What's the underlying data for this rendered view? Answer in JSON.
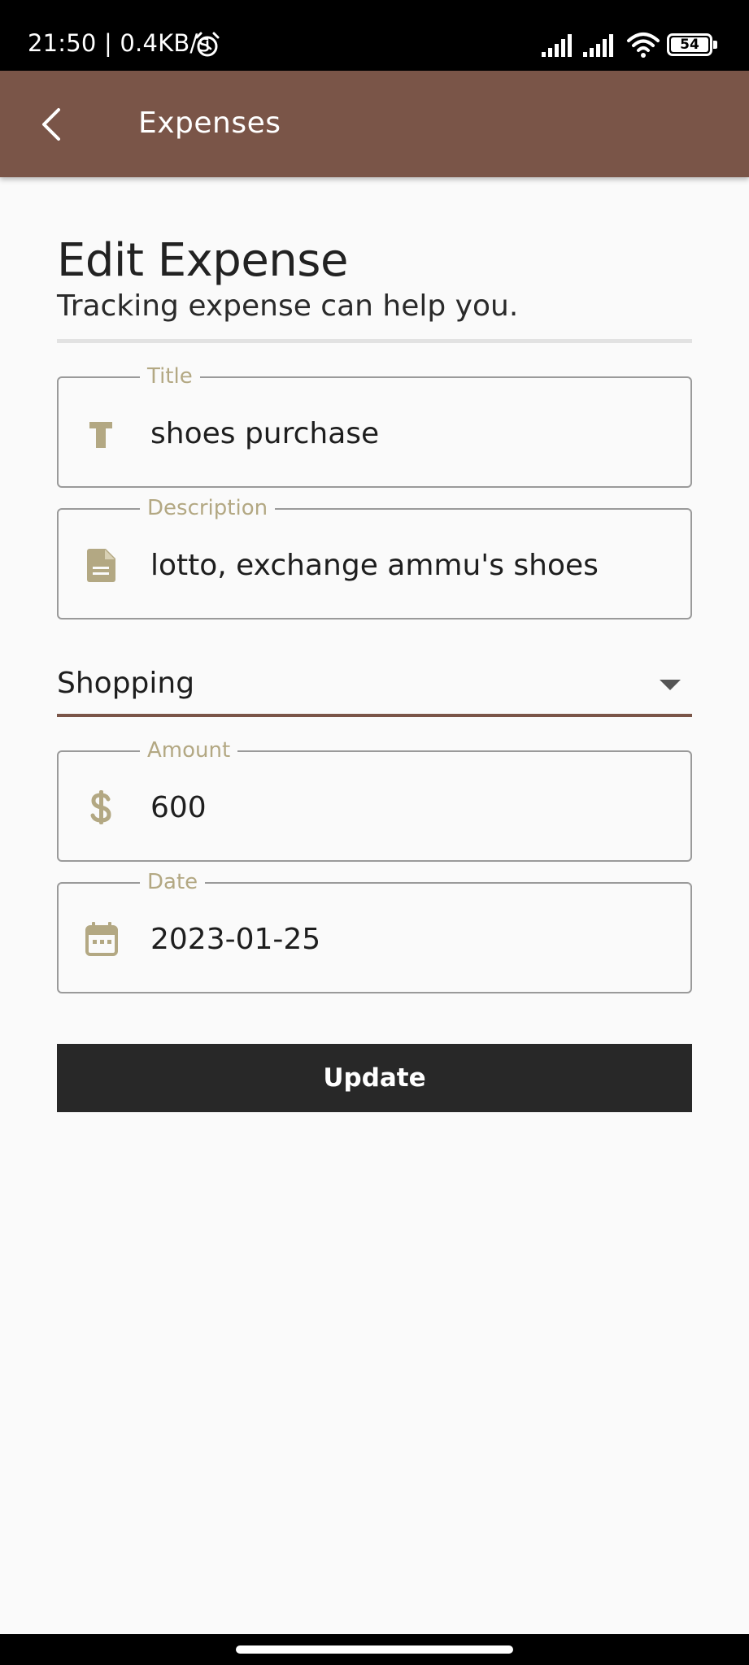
{
  "status_bar": {
    "time_speed": "21:50 | 0.4KB/s",
    "battery_level": "54",
    "icons": [
      "alarm-icon",
      "signal-icon",
      "signal-icon",
      "wifi-icon",
      "battery-icon"
    ]
  },
  "app_bar": {
    "title": "Expenses",
    "back_icon": "chevron-left-icon",
    "background": "#7a5548"
  },
  "form": {
    "heading": "Edit Expense",
    "subheading": "Tracking expense can help you.",
    "title_field": {
      "label": "Title",
      "value": "shoes purchase",
      "icon": "text-t-icon"
    },
    "description_field": {
      "label": "Description",
      "value": "lotto, exchange ammu's shoes",
      "icon": "document-icon"
    },
    "category_select": {
      "value": "Shopping",
      "icon": "dropdown-caret-icon"
    },
    "amount_field": {
      "label": "Amount",
      "value": "600",
      "icon": "dollar-icon"
    },
    "date_field": {
      "label": "Date",
      "value": "2023-01-25",
      "icon": "calendar-icon"
    },
    "submit_label": "Update"
  },
  "colors": {
    "accent": "#7a5548",
    "icon_tint": "#b3a883",
    "button": "#282828"
  }
}
